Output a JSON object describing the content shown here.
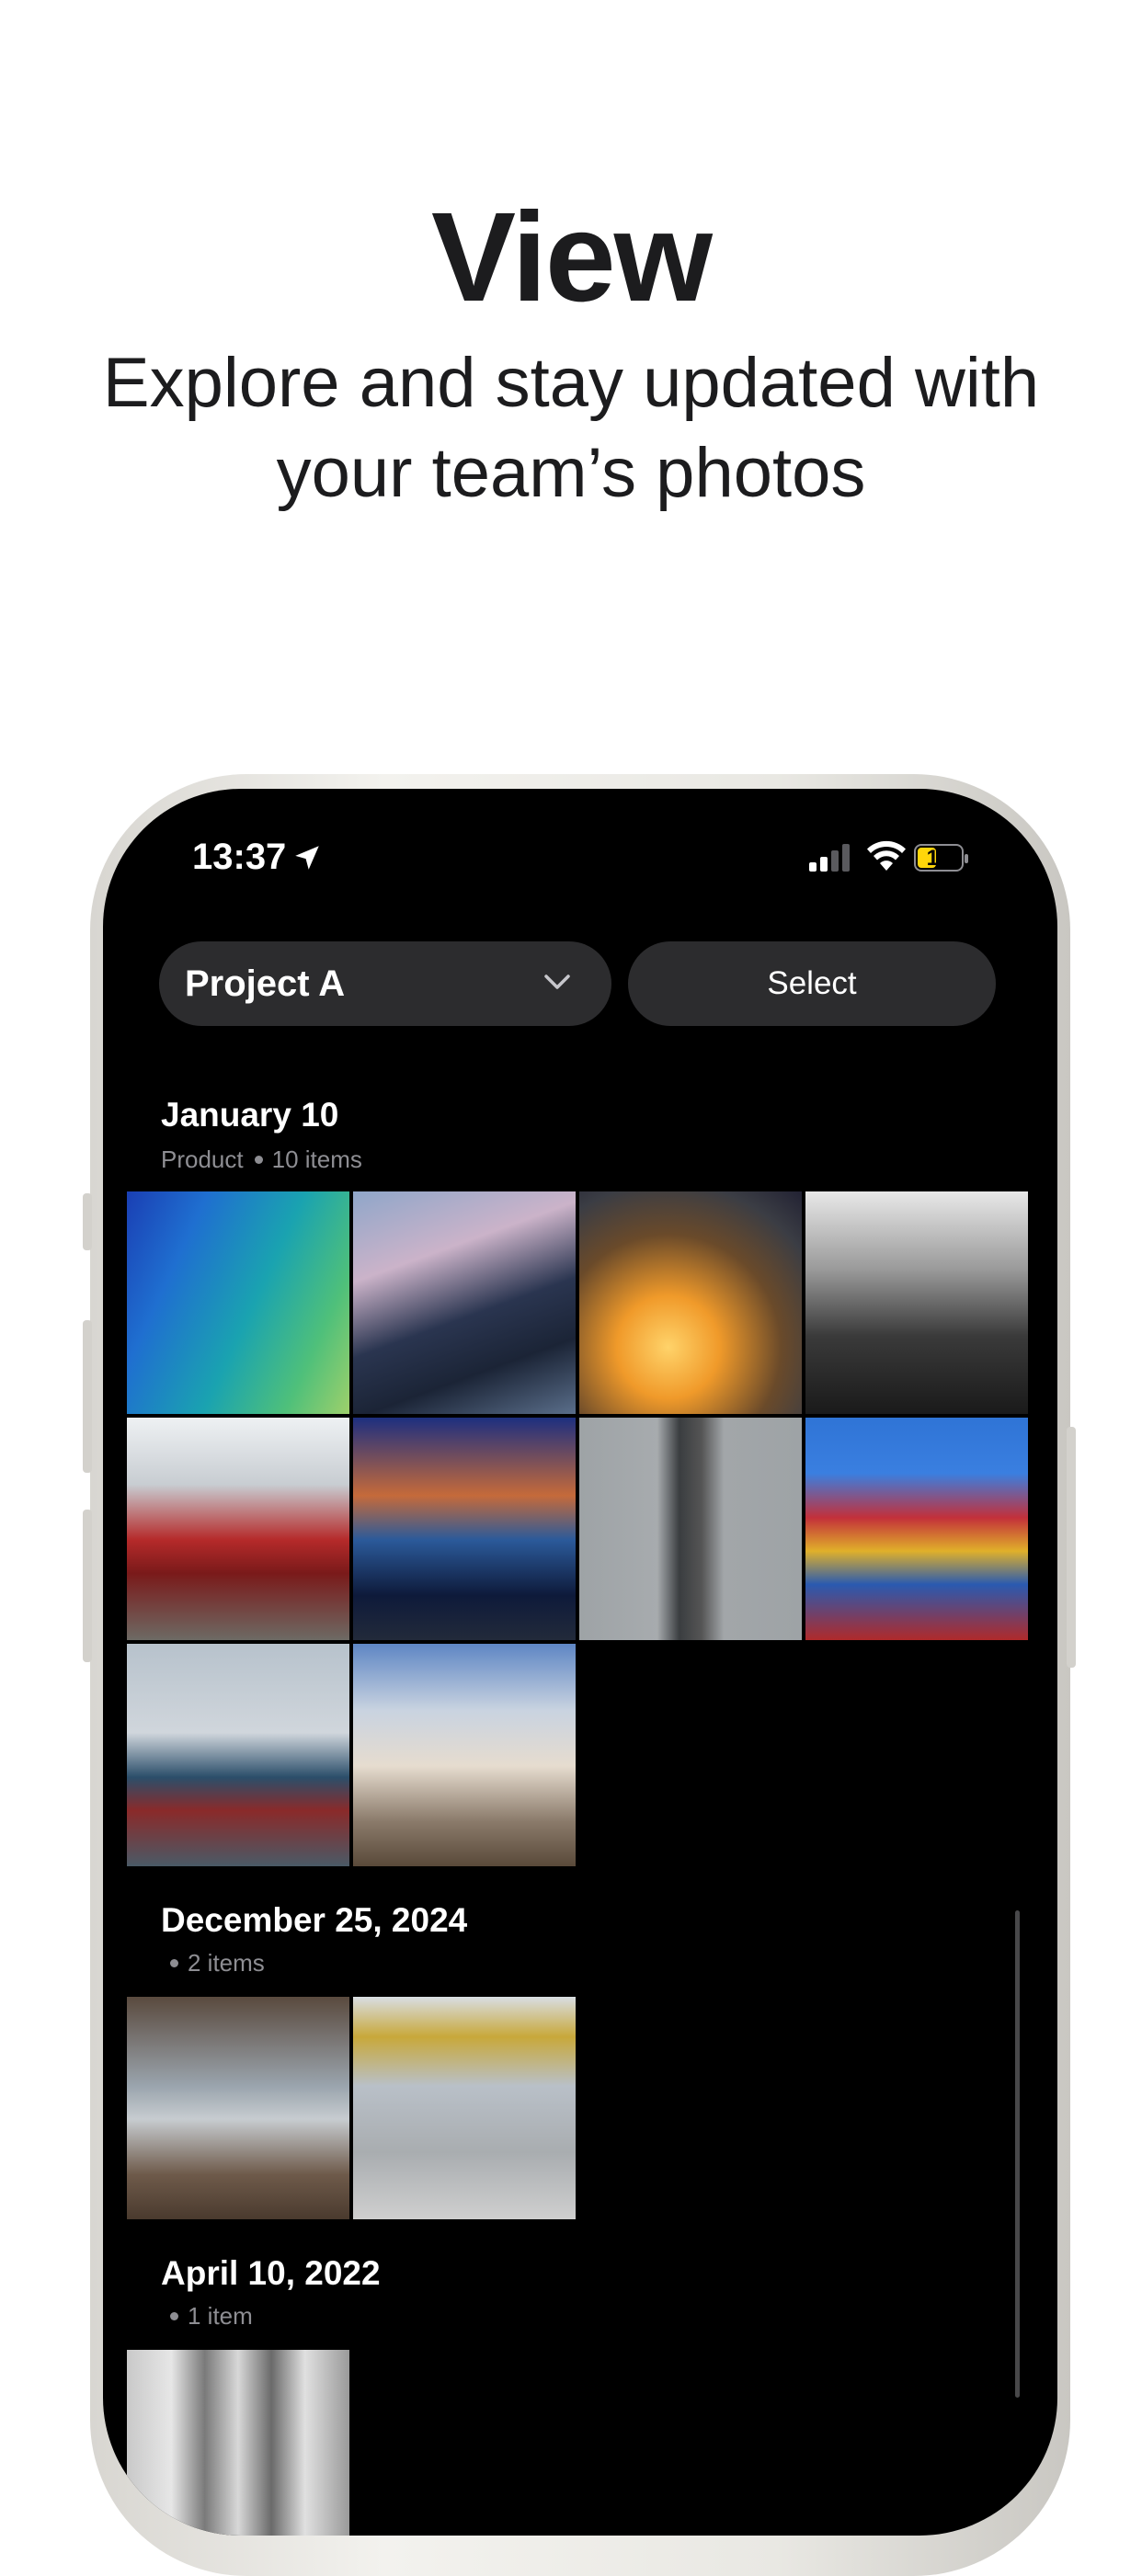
{
  "marketing": {
    "title": "View",
    "subtitle_line1": "Explore and stay updated with",
    "subtitle_line2": "your team’s photos"
  },
  "status_bar": {
    "time": "13:37",
    "battery": "14"
  },
  "toolbar": {
    "project_label": "Project A",
    "select_label": "Select"
  },
  "sections": [
    {
      "date": "January 10",
      "tag": "Product",
      "count": "10 items",
      "photos": [
        "green gradient abstract",
        "ship at container terminal",
        "angle grinder sparks",
        "industrial plant black and white",
        "red container reach stacker",
        "container ship at night",
        "steel chimney stack",
        "stacked shipping containers",
        "cargo ship with crane",
        "cooling towers"
      ]
    },
    {
      "date": "December 25, 2024",
      "count": "2 items",
      "photos": [
        "empty factory hall",
        "worker in warehouse"
      ]
    },
    {
      "date": "April 10, 2022",
      "count": "1 item",
      "photos": [
        "industrial pipes valves"
      ]
    }
  ],
  "colors": {
    "background": "#ffffff",
    "screen": "#000000",
    "pill": "#2c2c2e",
    "text_primary": "#1c1c1e",
    "meta": "#8e8e93",
    "battery_fill": "#ffd60a"
  }
}
